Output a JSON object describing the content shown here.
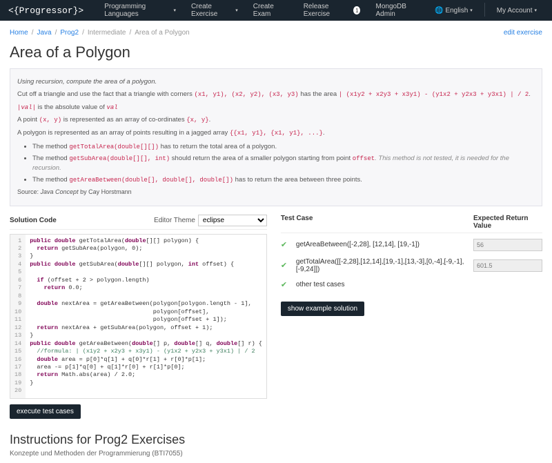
{
  "nav": {
    "brand": "<{Progressor}>",
    "items": [
      "Programming Languages",
      "Create Exercise",
      "Create Exam",
      "Release Exercise",
      "MongoDB Admin"
    ],
    "release_count": "1",
    "lang": "English",
    "account": "My Account"
  },
  "breadcrumb": {
    "home": "Home",
    "lang": "Java",
    "cat": "Prog2",
    "level": "Intermediate",
    "title": "Area of a Polygon",
    "edit": "edit exercise"
  },
  "title": "Area of a Polygon",
  "desc": {
    "p1_i": "Using recursion, compute the area of a polygon.",
    "p2a": "Cut off a triangle and use the fact that a triangle with corners ",
    "p2_c1": "(x1, y1), (x2, y2), (x3, y3)",
    "p2b": " has the area ",
    "p2_c2": "| (x1y2 + x2y3 + x3y1) - (y1x2 + y2x3 + y3x1) | / 2",
    "p2c": ".",
    "p3_c1": "|val|",
    "p3a": " is the absolute value of ",
    "p3_c2": "val",
    "p4a": "A point ",
    "p4_c1": "(x, y)",
    "p4b": " is represented as an array of co-ordinates ",
    "p4_c2": "{x, y}",
    "p4c": ".",
    "p5a": "A polygon is represented as an array of points resulting in a jagged array ",
    "p5_c1": "{{x1, y1}, {x1, y1}, ...}",
    "p5b": ".",
    "li1a": "The method ",
    "li1_c": "getTotalArea(double[][])",
    "li1b": " has to return the total area of a polygon.",
    "li2a": "The method ",
    "li2_c": "getSubArea(double[][], int)",
    "li2b": " should return the area of a smaller polygon starting from point ",
    "li2_c2": "offset",
    "li2m": ". This method is not tested, it is needed for the recursion.",
    "li3a": "The method ",
    "li3_c": "getAreaBetween(double[], double[], double[])",
    "li3b": " has to return the area between three points.",
    "src_a": "Source: ",
    "src_i": "Java Concept",
    "src_b": " by Cay Horstmann"
  },
  "solution": {
    "label": "Solution Code",
    "theme_label": "Editor Theme",
    "theme_value": "eclipse",
    "lines": 20,
    "exec": "execute test cases"
  },
  "tests": {
    "label": "Test Case",
    "expected_label": "Expected Return Value",
    "rows": [
      {
        "name": "getAreaBetween([-2,28], [12,14], [19,-1])",
        "val": "56"
      },
      {
        "name": "getTotalArea([[-2,28],[12,14],[19,-1],[13,-3],[0,-4],[-9,-1],[-9,24]])",
        "val": "601.5"
      }
    ],
    "other": "other test cases",
    "show": "show example solution"
  },
  "instructions": {
    "title": "Instructions for Prog2 Exercises",
    "sub": "Konzepte und Methoden der Programmierung (BTI7055)"
  },
  "chart_data": null
}
